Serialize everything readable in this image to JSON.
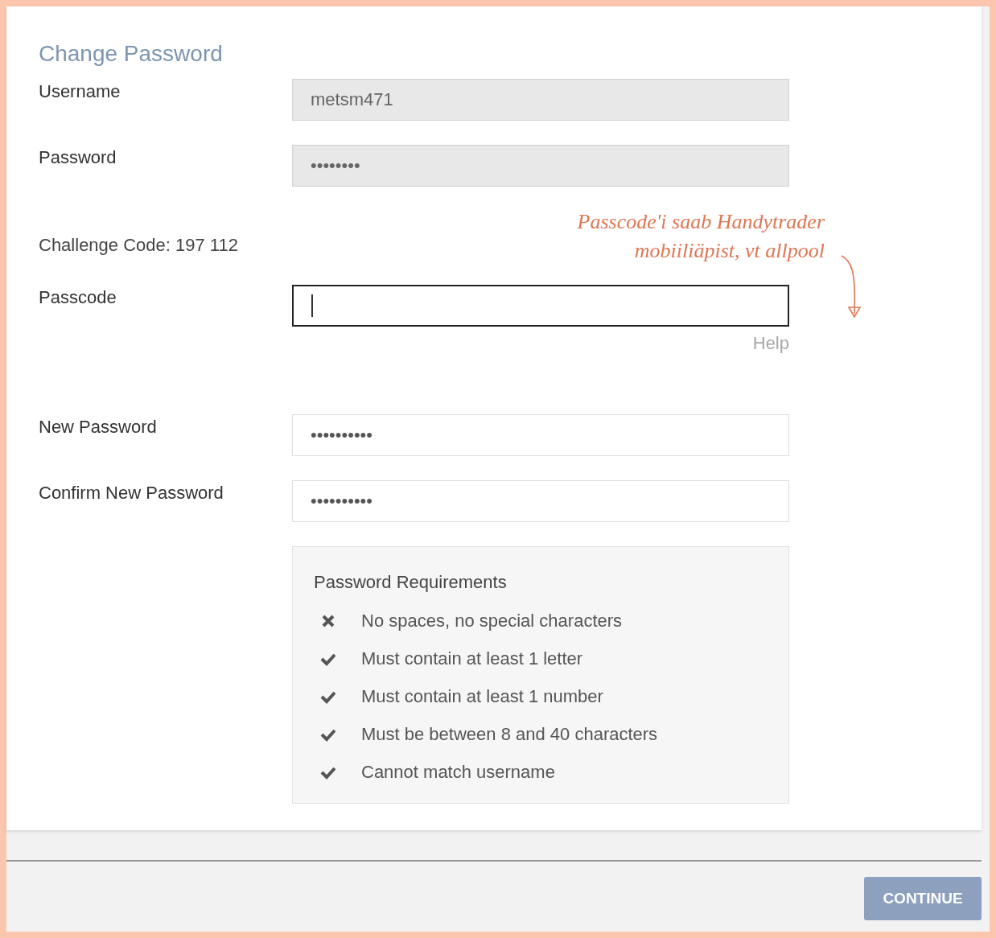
{
  "title": "Change Password",
  "rows": [
    {
      "kind": "field",
      "label": "Username",
      "value": "metsm471",
      "disabled": true,
      "focused": false
    },
    {
      "kind": "field",
      "label": "Password",
      "value": "••••••••",
      "disabled": true,
      "focused": false
    },
    {
      "kind": "text",
      "text": "Challenge Code: 197 112"
    },
    {
      "kind": "field",
      "label": "Passcode",
      "value": "",
      "disabled": false,
      "focused": true,
      "help": "Help"
    },
    {
      "kind": "field",
      "label": "New Password",
      "value": "••••••••••",
      "disabled": false,
      "focused": false
    },
    {
      "kind": "field",
      "label": "Confirm New Password",
      "value": "••••••••••",
      "disabled": false,
      "focused": false
    }
  ],
  "annotation": [
    "Passcode'i saab Handytrader",
    "mobiiliäpist, vt allpool"
  ],
  "requirements": {
    "title": "Password Requirements",
    "items": [
      {
        "text": "No spaces, no special characters",
        "met": false
      },
      {
        "text": "Must contain at least 1 letter",
        "met": true
      },
      {
        "text": "Must contain at least 1 number",
        "met": true
      },
      {
        "text": "Must be between 8 and 40 characters",
        "met": true
      },
      {
        "text": "Cannot match username",
        "met": true
      }
    ]
  },
  "button": "CONTINUE"
}
